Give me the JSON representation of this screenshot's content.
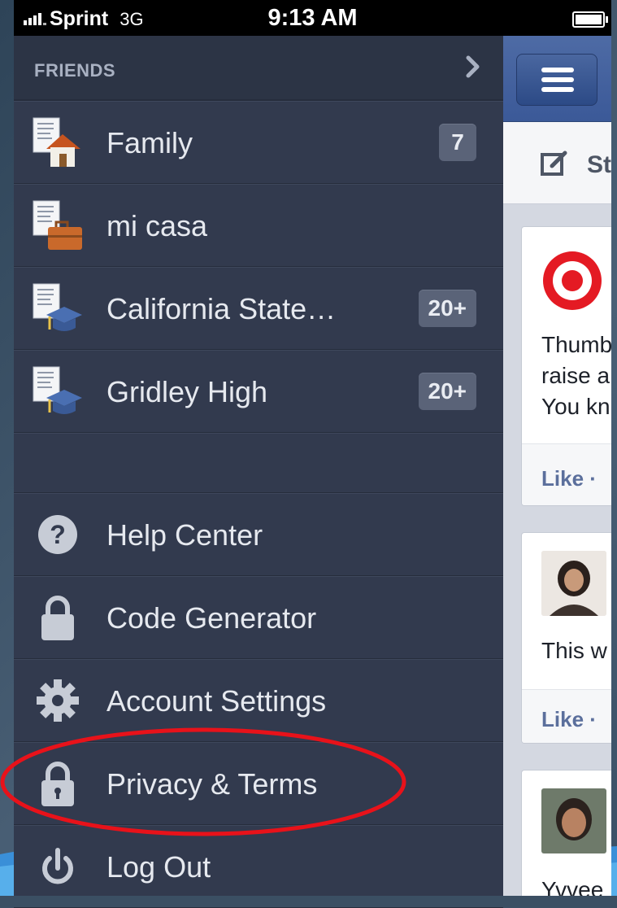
{
  "status_bar": {
    "carrier": "Sprint",
    "network": "3G",
    "time": "9:13 AM"
  },
  "menu": {
    "section_title": "FRIENDS",
    "groups": [
      {
        "label": "Family",
        "badge": "7",
        "icon": "family-group-icon"
      },
      {
        "label": "mi casa",
        "badge": "",
        "icon": "work-group-icon"
      },
      {
        "label": "California State…",
        "badge": "20+",
        "icon": "school-group-icon"
      },
      {
        "label": "Gridley High",
        "badge": "20+",
        "icon": "school-group-icon"
      }
    ],
    "actions": [
      {
        "label": "Help Center",
        "icon": "help-icon"
      },
      {
        "label": "Code Generator",
        "icon": "lock-icon"
      },
      {
        "label": "Account Settings",
        "icon": "gear-icon"
      },
      {
        "label": "Privacy & Terms",
        "icon": "privacy-lock-icon"
      },
      {
        "label": "Log Out",
        "icon": "power-icon"
      }
    ]
  },
  "feed": {
    "composer_label": "St",
    "posts": [
      {
        "lines": [
          "Thumb",
          "raise a",
          "You kn"
        ],
        "like_label": "Like ·"
      },
      {
        "lines": [
          "This w"
        ],
        "like_label": "Like ·"
      },
      {
        "lines": [
          "Yvvee"
        ]
      }
    ]
  },
  "colors": {
    "menu_bg": "#323a4e",
    "facebook_blue": "#3b5998",
    "highlight_ellipse": "#e8121a"
  }
}
